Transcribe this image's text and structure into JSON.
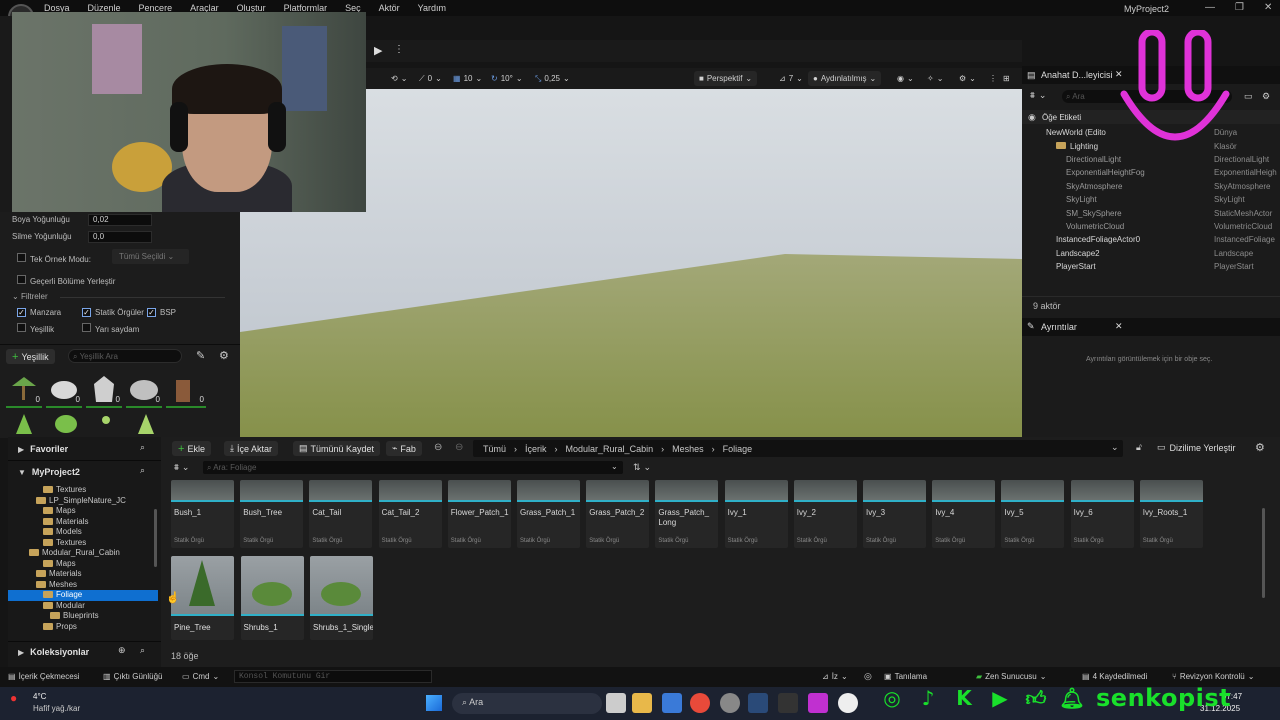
{
  "window": {
    "title": "MyProject2",
    "minimize": "—",
    "maximize": "❐",
    "close": "✕"
  },
  "menu": [
    "Dosya",
    "Düzenle",
    "Pencere",
    "Araçlar",
    "Oluştur",
    "Platformlar",
    "Seç",
    "Aktör",
    "Yardım"
  ],
  "foliage_panel": {
    "paint_density_label": "Boya Yoğunluğu",
    "paint_density": "0,02",
    "erase_density_label": "Silme Yoğunluğu",
    "erase_density": "0,0",
    "single_instance_label": "Tek Örnek Modu:",
    "single_instance_value": "Tümü Seçildi",
    "place_current_level": "Geçerli Bölüme Yerleştir",
    "filters_label": "Filtreler",
    "filters": [
      {
        "label": "Manzara",
        "checked": true
      },
      {
        "label": "Statik Örgüler",
        "checked": true
      },
      {
        "label": "BSP",
        "checked": true
      },
      {
        "label": "Yeşillik",
        "checked": false
      },
      {
        "label": "Yarı saydam",
        "checked": false
      }
    ],
    "add_button": "Yeşillik",
    "search_placeholder": "Yeşillik Ara",
    "counts": [
      "0",
      "0",
      "0",
      "0",
      "0"
    ]
  },
  "viewport_toolbar": {
    "snap_rot": "0",
    "grid": "10",
    "angle": "10°",
    "scale": "0,25",
    "view_mode": "Perspektif",
    "camera_speed": "7",
    "lit_mode": "Aydınlatılmış"
  },
  "outliner": {
    "tab": "Anahat D...leyicisi",
    "search_placeholder": "Ara",
    "column": "Öğe Etiketi",
    "rows": [
      {
        "name": "NewWorld (Edito",
        "type": "Dünya",
        "indent": 1
      },
      {
        "name": "Lighting",
        "type": "Klasör",
        "indent": 2
      },
      {
        "name": "DirectionalLight",
        "type": "DirectionalLight",
        "indent": 3
      },
      {
        "name": "ExponentialHeightFog",
        "type": "ExponentialHeigh",
        "indent": 3
      },
      {
        "name": "SkyAtmosphere",
        "type": "SkyAtmosphere",
        "indent": 3
      },
      {
        "name": "SkyLight",
        "type": "SkyLight",
        "indent": 3
      },
      {
        "name": "SM_SkySphere",
        "type": "StaticMeshActor",
        "indent": 3
      },
      {
        "name": "VolumetricCloud",
        "type": "VolumetricCloud",
        "indent": 3
      },
      {
        "name": "InstancedFoliageActor0",
        "type": "InstancedFoliage",
        "indent": 2
      },
      {
        "name": "Landscape2",
        "type": "Landscape",
        "indent": 2
      },
      {
        "name": "PlayerStart",
        "type": "PlayerStart",
        "indent": 2
      }
    ],
    "count": "9 aktör"
  },
  "details": {
    "tab": "Ayrıntılar",
    "empty_msg": "Ayrıntıları görüntülemek için bir obje seç."
  },
  "content_browser": {
    "favorites": "Favoriler",
    "project": "MyProject2",
    "collections": "Koleksiyonlar",
    "tree": [
      {
        "label": "Textures",
        "indent": 3,
        "selected": false
      },
      {
        "label": "LP_SimpleNature_JC",
        "indent": 2,
        "selected": false
      },
      {
        "label": "Maps",
        "indent": 3,
        "selected": false
      },
      {
        "label": "Materials",
        "indent": 3,
        "selected": false
      },
      {
        "label": "Models",
        "indent": 3,
        "selected": false
      },
      {
        "label": "Textures",
        "indent": 3,
        "selected": false
      },
      {
        "label": "Modular_Rural_Cabin",
        "indent": 1,
        "selected": false
      },
      {
        "label": "Maps",
        "indent": 3,
        "selected": false
      },
      {
        "label": "Materials",
        "indent": 2,
        "selected": false
      },
      {
        "label": "Meshes",
        "indent": 2,
        "selected": false
      },
      {
        "label": "Foliage",
        "indent": 3,
        "selected": true
      },
      {
        "label": "Modular",
        "indent": 3,
        "selected": false
      },
      {
        "label": "Blueprints",
        "indent": 4,
        "selected": false
      },
      {
        "label": "Props",
        "indent": 3,
        "selected": false
      }
    ],
    "buttons": {
      "add": "Ekle",
      "import": "İçe Aktar",
      "save_all": "Tümünü Kaydet",
      "fab": "Fab"
    },
    "breadcrumb": [
      "Tümü",
      "İçerik",
      "Modular_Rural_Cabin",
      "Meshes",
      "Foliage"
    ],
    "dock": "Dizilime Yerleştir",
    "search_placeholder": "Ara: Foliage",
    "asset_type": "Statik Örgü",
    "assets_row1": [
      "Bush_1",
      "Bush_Tree",
      "Cat_Tail",
      "Cat_Tail_2",
      "Flower_Patch_1",
      "Grass_Patch_1",
      "Grass_Patch_2",
      "Grass_Patch_ Long",
      "Ivy_1",
      "Ivy_2",
      "Ivy_3",
      "Ivy_4",
      "Ivy_5",
      "Ivy_6",
      "Ivy_Roots_1"
    ],
    "assets_row2": [
      "Pine_Tree",
      "Shrubs_1",
      "Shrubs_1_Single"
    ],
    "count": "18 öğe"
  },
  "statusbar": {
    "drawer": "İçerik Çekmecesi",
    "output": "Çıktı Günlüğü",
    "cmd": "Cmd",
    "console_placeholder": "Konsol Komutunu Gir",
    "trace": "İz",
    "diag": "Tanılama",
    "zen": "Zen Sunucusu",
    "saved": "4 Kaydedilmedi",
    "revision": "Revizyon Kontrolü"
  },
  "taskbar": {
    "weather_temp": "4°C",
    "weather_desc": "Hafif yağ./kar",
    "search": "Ara",
    "time": "07:47",
    "date": "31.12.2025"
  },
  "overlay": {
    "brand": "senkopist",
    "accent": "#19e02b",
    "smiley": "#e032d8"
  }
}
